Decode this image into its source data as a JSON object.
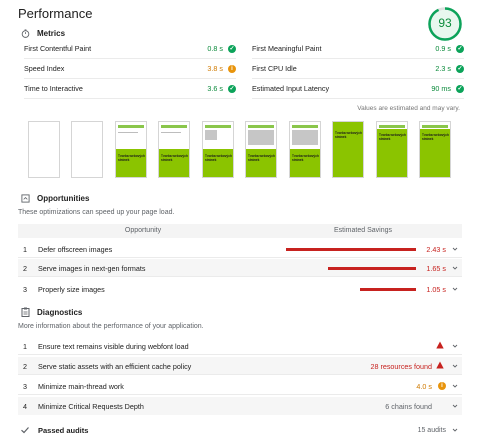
{
  "header": {
    "title": "Performance",
    "score": "93"
  },
  "metrics": {
    "heading": "Metrics",
    "left": [
      {
        "label": "First Contentful Paint",
        "value": "0.8 s",
        "status": "pass"
      },
      {
        "label": "Speed Index",
        "value": "3.8 s",
        "status": "average"
      },
      {
        "label": "Time to Interactive",
        "value": "3.6 s",
        "status": "pass"
      }
    ],
    "right": [
      {
        "label": "First Meaningful Paint",
        "value": "0.9 s",
        "status": "pass"
      },
      {
        "label": "First CPU Idle",
        "value": "2.3 s",
        "status": "pass"
      },
      {
        "label": "Estimated Input Latency",
        "value": "90 ms",
        "status": "pass"
      }
    ],
    "note": "Values are estimated and may vary."
  },
  "filmstrip": {
    "frame_text": [
      "Tvorba webových stránek"
    ]
  },
  "opportunities": {
    "heading": "Opportunities",
    "description": "These optimizations can speed up your page load.",
    "col_opportunity": "Opportunity",
    "col_savings": "Estimated Savings",
    "items": [
      {
        "index": "1",
        "label": "Defer offscreen images",
        "savings": "2.43 s",
        "savings_s": 2.43
      },
      {
        "index": "2",
        "label": "Serve images in next-gen formats",
        "savings": "1.65 s",
        "savings_s": 1.65
      },
      {
        "index": "3",
        "label": "Properly size images",
        "savings": "1.05 s",
        "savings_s": 1.05
      }
    ]
  },
  "diagnostics": {
    "heading": "Diagnostics",
    "description": "More information about the performance of your application.",
    "items": [
      {
        "index": "1",
        "label": "Ensure text remains visible during webfont load",
        "detail": ""
      },
      {
        "index": "2",
        "label": "Serve static assets with an efficient cache policy",
        "detail": "28 resources found"
      },
      {
        "index": "3",
        "label": "Minimize main-thread work",
        "detail": "4.0 s"
      },
      {
        "index": "4",
        "label": "Minimize Critical Requests Depth",
        "detail": "6 chains found"
      }
    ]
  },
  "passed": {
    "label": "Passed audits",
    "count": "15 audits"
  },
  "colors": {
    "pass": "#0ca35a",
    "average": "#e8940c",
    "fail": "#c7221f",
    "brand_green": "#8bc400"
  }
}
